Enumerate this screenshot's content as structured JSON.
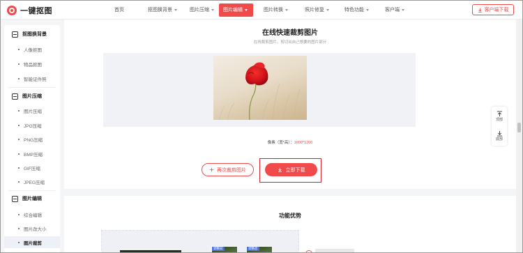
{
  "brand": {
    "name": "一键抠图",
    "accent": "#f04a4a"
  },
  "nav": {
    "items": [
      {
        "label": "首页",
        "dropdown": false
      },
      {
        "label": "抠图换背景",
        "dropdown": true
      },
      {
        "label": "图片压缩",
        "dropdown": true
      },
      {
        "label": "图片编辑",
        "dropdown": true,
        "active": true
      },
      {
        "label": "图片转换",
        "dropdown": true
      },
      {
        "label": "照片修复",
        "dropdown": true
      },
      {
        "label": "特色功能",
        "dropdown": true
      },
      {
        "label": "客户端",
        "dropdown": true
      }
    ],
    "download_label": "客户端下载"
  },
  "sidebar": {
    "sections": [
      {
        "title": "抠图换背景",
        "icon": "crop-square-icon",
        "items": [
          "人像抠图",
          "物品抠图",
          "智能证件照"
        ]
      },
      {
        "title": "图片压缩",
        "icon": "compress-square-icon",
        "items": [
          "图片压缩",
          "JPG压缩",
          "PNG压缩",
          "BMP压缩",
          "GIF压缩",
          "JPEG压缩"
        ]
      },
      {
        "title": "图片编辑",
        "icon": "edit-square-icon",
        "items": [
          "综合编辑",
          "图片改大小",
          "图片裁剪"
        ]
      }
    ],
    "active_item": "图片裁剪"
  },
  "main": {
    "title": "在线快速裁剪图片",
    "subtitle": "在线裁剪图片，剪切出自己想要的图片部分",
    "pixel_label": "像素（宽*高）：",
    "pixel_value": "1800*1200",
    "again_label": "再次裁剪图片",
    "download_now_label": "立即下载",
    "features_title": "功能优势",
    "feature_tags": [
      "调整前",
      "调整后"
    ]
  },
  "float": {
    "top_label": "顶部",
    "bottom_label": "底部"
  }
}
